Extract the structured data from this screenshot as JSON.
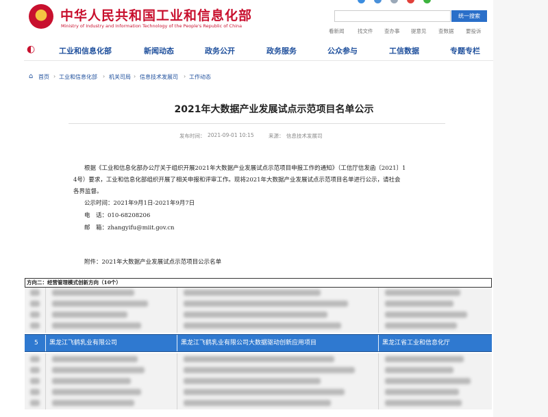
{
  "header": {
    "site_title": "中华人民共和国工业和信息化部",
    "site_subtitle": "Ministry of Industry and Information Technology of the People's Republic of China",
    "search_button": "统一搜索",
    "quick_links": [
      "看新闻",
      "找文件",
      "查办事",
      "提意见",
      "查数据",
      "要投诉"
    ]
  },
  "nav": {
    "items": [
      "工业和信息化部",
      "新闻动态",
      "政务公开",
      "政务服务",
      "公众参与",
      "工信数据",
      "专题专栏"
    ]
  },
  "breadcrumb": [
    "首页",
    "工业和信息化部",
    "机关司局",
    "信息技术发展司",
    "工作动态"
  ],
  "article": {
    "title": "2021年大数据产业发展试点示范项目名单公示",
    "publish_label": "发布时间：",
    "publish_time": "2021-09-01 10:15",
    "source_label": "来源：",
    "source": "信息技术发展司",
    "para_line1": "根据《工业和信息化部办公厅关于组织开展2021年大数据产业发展试点示范项目申报工作的通知》（工信厅信发函〔2021〕1",
    "para_line2": "4号）要求，工业和信息化部组织开展了相关申报和评审工作。现将2021年大数据产业发展试点示范项目名单进行公示，请社会",
    "para_line3": "各界监督。",
    "period": "公示时间：2021年9月1日-2021年9月7日",
    "phone": "电　话：010-68208206",
    "email": "邮　箱：zhangyifu@miit.gov.cn",
    "attachment": "附件：2021年大数据产业发展试点示范项目公示名单"
  },
  "table": {
    "section_header": "方向二：经营管理模式创新方向（10个）",
    "highlighted_row": {
      "index": "5",
      "company": "黑龙江飞鹤乳业有限公司",
      "project": "黑龙江飞鹤乳业有限公司大数据驱动创新应用项目",
      "department": "黑龙江省工业和信息化厅"
    }
  },
  "colors": {
    "brand_red": "#c8102e",
    "nav_blue": "#1e4f9c",
    "highlight_blue": "#2f79d0",
    "search_blue": "#2a6fc9"
  }
}
